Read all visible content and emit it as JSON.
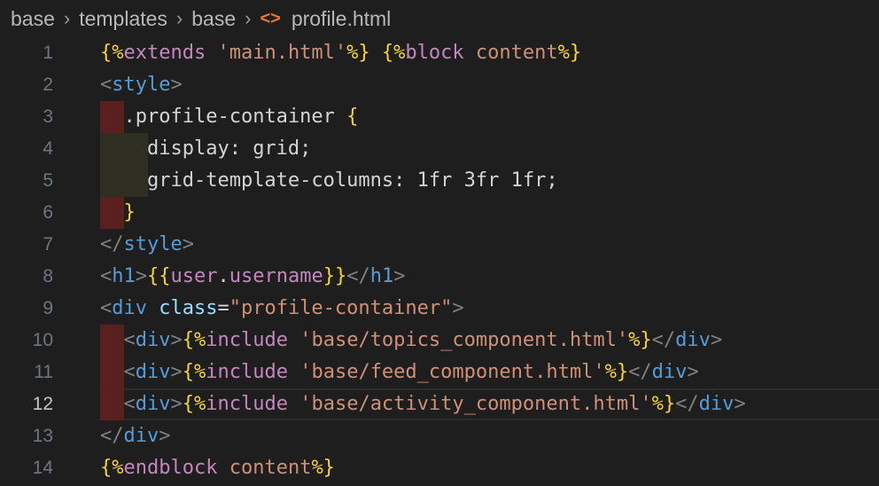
{
  "breadcrumb": {
    "items": [
      "base",
      "templates",
      "base"
    ],
    "file": "profile.html",
    "file_icon": "<>"
  },
  "colors": {
    "background": "#1e1e1e",
    "line_number": "#6e7681",
    "line_number_active": "#c6c6c6",
    "indent_error": "#5a1f1f",
    "indent_warn": "#2e2f22"
  },
  "lines": [
    {
      "n": "1",
      "tokens": [
        [
          "{%",
          "t-bracket-y"
        ],
        [
          "extends ",
          "t-kw"
        ],
        [
          "'main.html'",
          "t-str"
        ],
        [
          "%}",
          "t-bracket-y"
        ],
        [
          " ",
          "t-plain"
        ],
        [
          "{%",
          "t-bracket-y"
        ],
        [
          "block ",
          "t-kw"
        ],
        [
          "content",
          "t-str"
        ],
        [
          "%}",
          "t-bracket-y"
        ]
      ]
    },
    {
      "n": "2",
      "tokens": [
        [
          "<",
          "t-punc"
        ],
        [
          "style",
          "t-tag"
        ],
        [
          ">",
          "t-punc"
        ]
      ]
    },
    {
      "n": "3",
      "tokens": [
        [
          "  ",
          "t-plain"
        ],
        [
          ".profile-container ",
          "t-plain"
        ],
        [
          "{",
          "t-bracket-y"
        ]
      ]
    },
    {
      "n": "4",
      "tokens": [
        [
          "    ",
          "t-plain"
        ],
        [
          "display: grid;",
          "t-plain"
        ]
      ]
    },
    {
      "n": "5",
      "tokens": [
        [
          "    ",
          "t-plain"
        ],
        [
          "grid-template-columns: 1fr 3fr 1fr;",
          "t-plain"
        ]
      ]
    },
    {
      "n": "6",
      "tokens": [
        [
          "  ",
          "t-plain"
        ],
        [
          "}",
          "t-bracket-y"
        ]
      ]
    },
    {
      "n": "7",
      "tokens": [
        [
          "</",
          "t-punc"
        ],
        [
          "style",
          "t-tag"
        ],
        [
          ">",
          "t-punc"
        ]
      ]
    },
    {
      "n": "8",
      "tokens": [
        [
          "<",
          "t-punc"
        ],
        [
          "h1",
          "t-tag"
        ],
        [
          ">",
          "t-punc"
        ],
        [
          "{{",
          "t-bracket-y"
        ],
        [
          "user",
          "t-kw"
        ],
        [
          ".",
          "t-plain"
        ],
        [
          "username",
          "t-kw"
        ],
        [
          "}}",
          "t-bracket-y"
        ],
        [
          "</",
          "t-punc"
        ],
        [
          "h1",
          "t-tag"
        ],
        [
          ">",
          "t-punc"
        ]
      ]
    },
    {
      "n": "9",
      "tokens": [
        [
          "<",
          "t-punc"
        ],
        [
          "div ",
          "t-tag"
        ],
        [
          "class",
          "t-attr"
        ],
        [
          "=",
          "t-plain"
        ],
        [
          "\"profile-container\"",
          "t-str"
        ],
        [
          ">",
          "t-punc"
        ]
      ]
    },
    {
      "n": "10",
      "tokens": [
        [
          "  ",
          "t-plain"
        ],
        [
          "<",
          "t-punc"
        ],
        [
          "div",
          "t-tag"
        ],
        [
          ">",
          "t-punc"
        ],
        [
          "{%",
          "t-bracket-y"
        ],
        [
          "include ",
          "t-kw"
        ],
        [
          "'base/topics_component.html'",
          "t-str"
        ],
        [
          "%}",
          "t-bracket-y"
        ],
        [
          "</",
          "t-punc"
        ],
        [
          "div",
          "t-tag"
        ],
        [
          ">",
          "t-punc"
        ]
      ]
    },
    {
      "n": "11",
      "tokens": [
        [
          "  ",
          "t-plain"
        ],
        [
          "<",
          "t-punc"
        ],
        [
          "div",
          "t-tag"
        ],
        [
          ">",
          "t-punc"
        ],
        [
          "{%",
          "t-bracket-y"
        ],
        [
          "include ",
          "t-kw"
        ],
        [
          "'base/feed_component.html'",
          "t-str"
        ],
        [
          "%}",
          "t-bracket-y"
        ],
        [
          "</",
          "t-punc"
        ],
        [
          "div",
          "t-tag"
        ],
        [
          ">",
          "t-punc"
        ]
      ]
    },
    {
      "n": "12",
      "tokens": [
        [
          "  ",
          "t-plain"
        ],
        [
          "<",
          "t-punc"
        ],
        [
          "div",
          "t-tag"
        ],
        [
          ">",
          "t-punc"
        ],
        [
          "{%",
          "t-bracket-y"
        ],
        [
          "include ",
          "t-kw"
        ],
        [
          "'base/activity_component.html'",
          "t-str"
        ],
        [
          "%}",
          "t-bracket-y"
        ],
        [
          "</",
          "t-punc"
        ],
        [
          "div",
          "t-tag"
        ],
        [
          ">",
          "t-punc"
        ]
      ]
    },
    {
      "n": "13",
      "tokens": [
        [
          "</",
          "t-punc"
        ],
        [
          "div",
          "t-tag"
        ],
        [
          ">",
          "t-punc"
        ]
      ]
    },
    {
      "n": "14",
      "tokens": [
        [
          "{%",
          "t-bracket-y"
        ],
        [
          "endblock ",
          "t-kw"
        ],
        [
          "content",
          "t-str"
        ],
        [
          "%}",
          "t-bracket-y"
        ]
      ]
    }
  ],
  "active_line": "12"
}
